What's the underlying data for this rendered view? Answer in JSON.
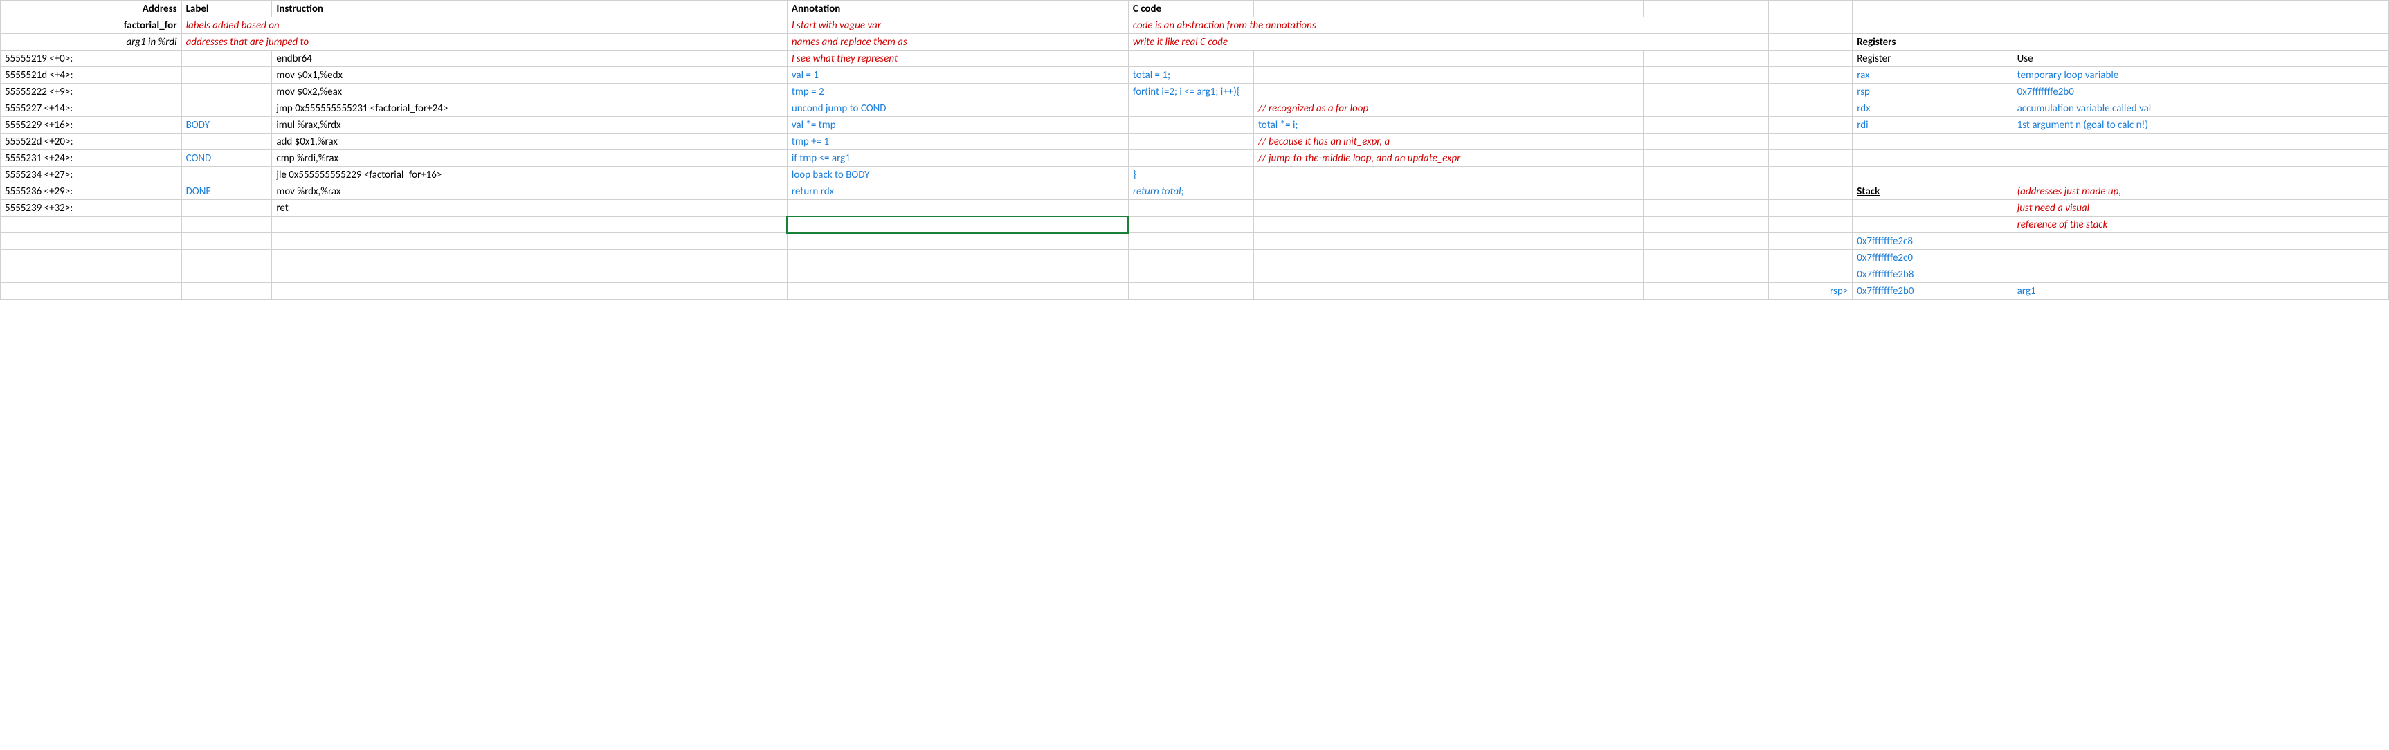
{
  "headers": {
    "address": "Address",
    "label": "Label",
    "instruction": "Instruction",
    "annotation": "Annotation",
    "ccode": "C code",
    "registers": "Registers",
    "register": "Register",
    "use": "Use",
    "stack": "Stack"
  },
  "row1": {
    "addr": "factorial_for",
    "label_note": "labels added based on",
    "anno": "I start with vague var",
    "code": "code is an abstraction from the annotations"
  },
  "row2": {
    "addr": "arg1 in %rdi",
    "label_note": " addresses that are jumped to",
    "anno": " names and replace them as",
    "code": "write it like real C code"
  },
  "rows": [
    {
      "addr": "55555219 <+0>:",
      "label": "",
      "instr": "endbr64",
      "anno": " I see what they represent",
      "anno_cls": "red",
      "code_a": "",
      "code_b": "",
      "reg": "Register",
      "reg_cls": "",
      "use": "Use",
      "use_cls": ""
    },
    {
      "addr": "5555521d <+4>:",
      "label": "",
      "instr": "mov    $0x1,%edx",
      "anno": "val = 1",
      "anno_cls": "blue",
      "code_a": "total = 1;",
      "code_b": "",
      "reg": "rax",
      "reg_cls": "blue",
      "use": "temporary loop variable",
      "use_cls": "blue"
    },
    {
      "addr": "55555222 <+9>:",
      "label": "",
      "instr": "mov    $0x2,%eax",
      "anno": "tmp = 2",
      "anno_cls": "blue",
      "code_a": "for(int i=2; i <= arg1; i++){",
      "code_b": "",
      "reg": "rsp",
      "reg_cls": "blue",
      "use": "0x7fffffffe2b0",
      "use_cls": "blue"
    },
    {
      "addr": "5555227 <+14>:",
      "label": "",
      "instr": "jmp    0x555555555231 <factorial_for+24>",
      "anno": "uncond jump to COND",
      "anno_cls": "blue",
      "code_a": "",
      "code_b": "// recognized as a for loop",
      "code_b_cls": "red",
      "reg": "rdx",
      "reg_cls": "blue",
      "use": "accumulation variable called val",
      "use_cls": "blue"
    },
    {
      "addr": "5555229 <+16>:",
      "label": "BODY",
      "instr": "imul   %rax,%rdx",
      "anno": "val *= tmp",
      "anno_cls": "blue",
      "code_a": "",
      "code_b": "total *= i;",
      "code_b_cls": "blue",
      "reg": "rdi",
      "reg_cls": "blue",
      "use": "1st argument n (goal to calc n!)",
      "use_cls": "blue"
    },
    {
      "addr": "555522d <+20>:",
      "label": "",
      "instr": "add    $0x1,%rax",
      "anno": "tmp += 1",
      "anno_cls": "blue",
      "code_a": "",
      "code_b": "// because it has an init_expr, a",
      "code_b_cls": "red",
      "reg": "",
      "reg_cls": "",
      "use": "",
      "use_cls": ""
    },
    {
      "addr": "5555231 <+24>:",
      "label": "COND",
      "instr": "cmp    %rdi,%rax",
      "anno": "if tmp <= arg1",
      "anno_cls": "blue",
      "code_a": "",
      "code_b": "//  jump-to-the-middle loop, and an update_expr",
      "code_b_cls": "red",
      "reg": "",
      "reg_cls": "",
      "use": "",
      "use_cls": ""
    },
    {
      "addr": "5555234 <+27>:",
      "label": "",
      "instr": "jle    0x555555555229 <factorial_for+16>",
      "anno": "loop back to BODY",
      "anno_cls": "blue",
      "code_a": "}",
      "code_b": "",
      "reg": "",
      "reg_cls": "",
      "use": "",
      "use_cls": ""
    },
    {
      "addr": "5555236 <+29>:",
      "label": "DONE",
      "instr": "mov    %rdx,%rax",
      "anno": "return rdx",
      "anno_cls": "blue",
      "code_a": "return total;",
      "code_a_cls": "blue ital",
      "code_b": "",
      "reg": "Stack",
      "reg_cls": "bold underline",
      "use": "(addresses just made up,",
      "use_cls": "red"
    },
    {
      "addr": "5555239 <+32>:",
      "label": "",
      "instr": "ret",
      "anno": "",
      "anno_cls": "",
      "code_a": "",
      "code_b": "",
      "reg": "",
      "reg_cls": "",
      "use": " just need a visual",
      "use_cls": "red"
    }
  ],
  "tail": [
    {
      "sp": "",
      "reg": "",
      "use": " reference of the stack",
      "use_cls": "red",
      "sel": true
    },
    {
      "sp": "",
      "reg": "0x7fffffffe2c8",
      "use": "",
      "use_cls": ""
    },
    {
      "sp": "",
      "reg": "0x7fffffffe2c0",
      "use": "",
      "use_cls": ""
    },
    {
      "sp": "",
      "reg": "0x7fffffffe2b8",
      "use": "",
      "use_cls": ""
    },
    {
      "sp": "rsp>",
      "reg": "0x7fffffffe2b0",
      "use": "arg1",
      "use_cls": "blue"
    }
  ]
}
